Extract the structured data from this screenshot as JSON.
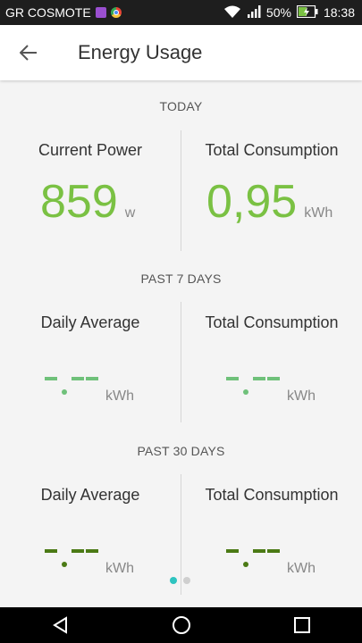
{
  "status_bar": {
    "carrier": "GR COSMOTE",
    "battery_percent": "50%",
    "time": "18:38",
    "icons": [
      "message-icon",
      "chrome-icon",
      "wifi-icon",
      "signal-icon",
      "battery-icon"
    ]
  },
  "app_bar": {
    "title": "Energy Usage",
    "back_icon": "arrow-left-icon"
  },
  "today": {
    "header": "TODAY",
    "left_label": "Current Power",
    "left_value": "859",
    "left_unit": "w",
    "right_label": "Total Consumption",
    "right_value": "0,95",
    "right_unit": "kWh"
  },
  "past7": {
    "header": "PAST 7 DAYS",
    "left_label": "Daily Average",
    "left_unit": "kWh",
    "right_label": "Total Consumption",
    "right_unit": "kWh"
  },
  "past30": {
    "header": "PAST 30 DAYS",
    "left_label": "Daily Average",
    "left_unit": "kWh",
    "right_label": "Total Consumption",
    "right_unit": "kWh"
  },
  "colors": {
    "accent_green": "#7ac143",
    "placeholder_7d": "#6fc17a",
    "placeholder_30d": "#4b7a15",
    "pager_active": "#2ec4c0",
    "pager_inactive": "#cfcfcf"
  },
  "pager": {
    "page_count": 2,
    "active_index": 0
  },
  "nav_bar": {
    "icons": [
      "back-triangle-icon",
      "home-circle-icon",
      "recents-square-icon"
    ]
  }
}
